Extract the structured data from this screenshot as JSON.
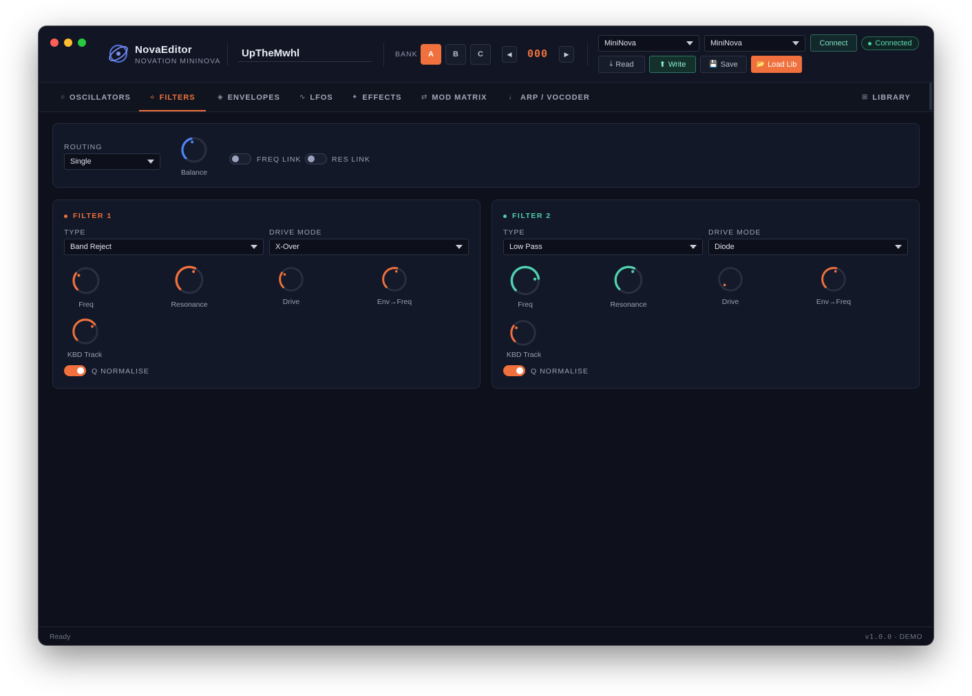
{
  "app": {
    "title": "NovaEditor",
    "subtitle": "NOVATION MININOVA",
    "patch_name": "UpTheMwhl"
  },
  "bank": {
    "label": "BANK",
    "buttons": [
      "A",
      "B",
      "C"
    ],
    "active": "A",
    "prev_icon": "◀",
    "next_icon": "▶",
    "program": "000"
  },
  "midi": {
    "input": "MiniNova",
    "output": "MiniNova",
    "connect_label": "Connect",
    "status": "Connected",
    "read_label": "Read",
    "write_label": "Write",
    "save_label": "Save",
    "load_label": "Load Lib"
  },
  "icons": {
    "read": "⤓",
    "write": "⬆",
    "save": "💾",
    "load": "📂"
  },
  "tabs": [
    {
      "label": "OSCILLATORS",
      "icon": "○"
    },
    {
      "label": "FILTERS",
      "icon": "⟡"
    },
    {
      "label": "ENVELOPES",
      "icon": "◈"
    },
    {
      "label": "LFOS",
      "icon": "∿"
    },
    {
      "label": "EFFECTS",
      "icon": "✦"
    },
    {
      "label": "MOD MATRIX",
      "icon": "⇄"
    },
    {
      "label": "ARP / VOCODER",
      "icon": "♩"
    },
    {
      "label": "LIBRARY",
      "icon": "⊞"
    }
  ],
  "active_tab": "FILTERS",
  "routing": {
    "label": "ROUTING",
    "value": "Single",
    "balance_label": "Balance",
    "balance_value": 0.45,
    "freq_link_label": "FREQ LINK",
    "freq_link_on": false,
    "res_link_label": "RES LINK",
    "res_link_on": false
  },
  "filter1": {
    "title": "FILTER 1",
    "type_label": "TYPE",
    "type": "Band Reject",
    "drive_mode_label": "DRIVE MODE",
    "drive_mode": "X-Over",
    "knobs": {
      "freq": {
        "label": "Freq",
        "value": 0.3
      },
      "resonance": {
        "label": "Resonance",
        "value": 0.6
      },
      "drive": {
        "label": "Drive",
        "value": 0.3
      },
      "env_freq": {
        "label": "Env→Freq",
        "value": 0.55
      },
      "kbd_track": {
        "label": "KBD Track",
        "value": 0.7
      }
    },
    "q_normalise_label": "Q NORMALISE",
    "q_normalise_on": true
  },
  "filter2": {
    "title": "FILTER 2",
    "type_label": "TYPE",
    "type": "Low Pass",
    "drive_mode_label": "DRIVE MODE",
    "drive_mode": "Diode",
    "knobs": {
      "freq": {
        "label": "Freq",
        "value": 0.8
      },
      "resonance": {
        "label": "Resonance",
        "value": 0.6
      },
      "drive": {
        "label": "Drive",
        "value": 0.0
      },
      "env_freq": {
        "label": "Env→Freq",
        "value": 0.55
      },
      "kbd_track": {
        "label": "KBD Track",
        "value": 0.3
      }
    },
    "q_normalise_label": "Q NORMALISE",
    "q_normalise_on": true
  },
  "colors": {
    "accent": "#f0713d",
    "filter2": "#4fd1b0",
    "balance": "#4f86f7",
    "track": "#2a2f42"
  },
  "statusbar": {
    "left": "Ready",
    "version": "v1.0.0",
    "separator": "·",
    "mode": "DEMO"
  }
}
